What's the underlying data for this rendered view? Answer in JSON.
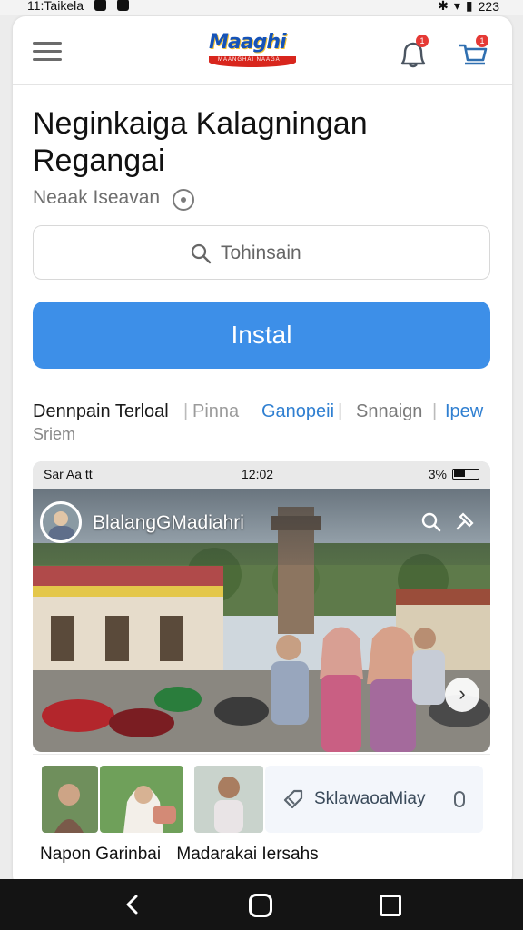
{
  "status_bar": {
    "time": "11:Taikela",
    "right_text": "223"
  },
  "header": {
    "logo_text": "Maaghi",
    "logo_subtext": "MAANGHAI NAAGAI",
    "bell_badge": "1",
    "cart_badge": "1"
  },
  "app": {
    "title": "Neginkaiga Kalagningan Regangai",
    "subtitle": "Neaak Iseavan"
  },
  "search": {
    "placeholder": "Tohinsain"
  },
  "install_label": "Instal",
  "tabs": {
    "items": [
      "Dennpain Terloal",
      "Pinna",
      "Ganopeii",
      "Snnaign",
      "Ipew"
    ],
    "sub": "Sriem"
  },
  "screenshot": {
    "status_left": "Sar Aa tt",
    "status_time": "12:02",
    "status_battery": "3%",
    "profile_name": "BlalangGMadiahri"
  },
  "thumbnails": {
    "chip_label": "SklawaoaMiay"
  },
  "captions": {
    "left": "Napon Garinbai",
    "right": "Madarakai Iersahs"
  },
  "colors": {
    "install_button": "#3d8fe8",
    "accent_blue": "#2f7fd1",
    "logo_red": "#d8261d"
  }
}
